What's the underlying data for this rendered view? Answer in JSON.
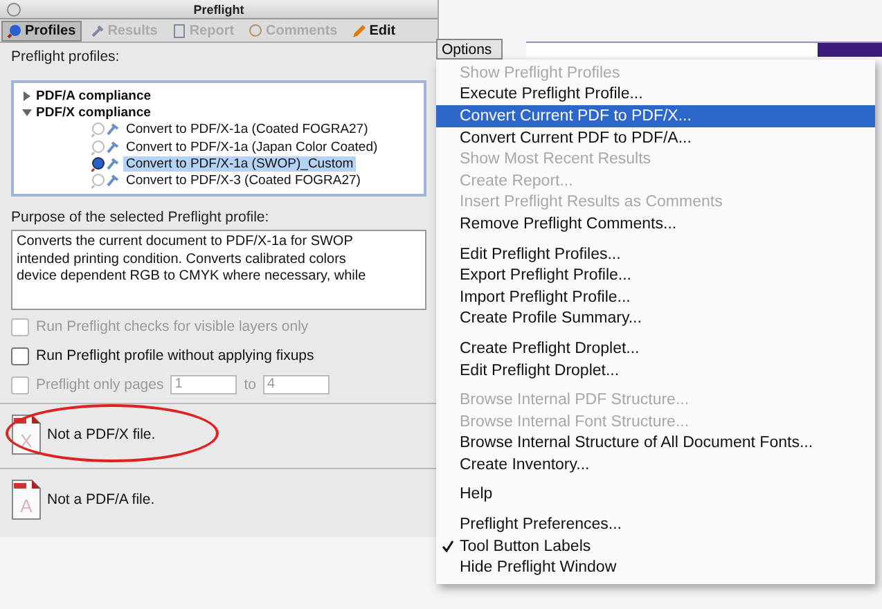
{
  "window": {
    "title": "Preflight"
  },
  "toolbar": [
    {
      "label": "Profiles",
      "selected": true,
      "disabled": false
    },
    {
      "label": "Results",
      "selected": false,
      "disabled": true
    },
    {
      "label": "Report",
      "selected": false,
      "disabled": true
    },
    {
      "label": "Comments",
      "selected": false,
      "disabled": true
    },
    {
      "label": "Edit",
      "selected": false,
      "disabled": false
    }
  ],
  "options_menu": {
    "label": "Options",
    "expanded": true,
    "items": [
      {
        "kind": "item",
        "label": "Show Preflight Profiles",
        "disabled": true,
        "selected": false,
        "checked": false
      },
      {
        "kind": "item",
        "label": "Execute Preflight Profile...",
        "disabled": false,
        "selected": false,
        "checked": false
      },
      {
        "kind": "item",
        "label": "Convert Current PDF to PDF/X...",
        "disabled": false,
        "selected": true,
        "checked": false
      },
      {
        "kind": "item",
        "label": "Convert Current PDF to PDF/A...",
        "disabled": false,
        "selected": false,
        "checked": false
      },
      {
        "kind": "item",
        "label": "Show Most Recent Results",
        "disabled": true,
        "selected": false,
        "checked": false
      },
      {
        "kind": "item",
        "label": "Create Report...",
        "disabled": true,
        "selected": false,
        "checked": false
      },
      {
        "kind": "item",
        "label": "Insert Preflight Results as Comments",
        "disabled": true,
        "selected": false,
        "checked": false
      },
      {
        "kind": "item",
        "label": "Remove Preflight Comments...",
        "disabled": false,
        "selected": false,
        "checked": false
      },
      {
        "kind": "separator"
      },
      {
        "kind": "item",
        "label": "Edit Preflight Profiles...",
        "disabled": false,
        "selected": false,
        "checked": false
      },
      {
        "kind": "item",
        "label": "Export Preflight Profile...",
        "disabled": false,
        "selected": false,
        "checked": false
      },
      {
        "kind": "item",
        "label": "Import Preflight Profile...",
        "disabled": false,
        "selected": false,
        "checked": false
      },
      {
        "kind": "item",
        "label": "Create Profile Summary...",
        "disabled": false,
        "selected": false,
        "checked": false
      },
      {
        "kind": "separator"
      },
      {
        "kind": "item",
        "label": "Create Preflight Droplet...",
        "disabled": false,
        "selected": false,
        "checked": false
      },
      {
        "kind": "item",
        "label": "Edit Preflight Droplet...",
        "disabled": false,
        "selected": false,
        "checked": false
      },
      {
        "kind": "separator"
      },
      {
        "kind": "item",
        "label": "Browse Internal PDF Structure...",
        "disabled": true,
        "selected": false,
        "checked": false
      },
      {
        "kind": "item",
        "label": "Browse Internal Font Structure...",
        "disabled": true,
        "selected": false,
        "checked": false
      },
      {
        "kind": "item",
        "label": "Browse Internal Structure of All Document Fonts...",
        "disabled": false,
        "selected": false,
        "checked": false
      },
      {
        "kind": "item",
        "label": "Create Inventory...",
        "disabled": false,
        "selected": false,
        "checked": false
      },
      {
        "kind": "separator"
      },
      {
        "kind": "item",
        "label": "Help",
        "disabled": false,
        "selected": false,
        "checked": false
      },
      {
        "kind": "separator"
      },
      {
        "kind": "item",
        "label": "Preflight Preferences...",
        "disabled": false,
        "selected": false,
        "checked": false
      },
      {
        "kind": "item",
        "label": "Tool Button Labels",
        "disabled": false,
        "selected": false,
        "checked": true
      },
      {
        "kind": "item",
        "label": "Hide Preflight Window",
        "disabled": false,
        "selected": false,
        "checked": false
      }
    ]
  },
  "profiles": {
    "label": "Preflight profiles:",
    "tree": [
      {
        "label": "PDF/A compliance",
        "expanded": false
      },
      {
        "label": "PDF/X compliance",
        "expanded": true,
        "children": [
          {
            "label": "Convert to PDF/X-1a (Coated FOGRA27)",
            "selected": false
          },
          {
            "label": "Convert to PDF/X-1a (Japan Color Coated)",
            "selected": false
          },
          {
            "label": "Convert to PDF/X-1a (SWOP)_Custom",
            "selected": true
          },
          {
            "label": "Convert to PDF/X-3 (Coated FOGRA27)",
            "selected": false
          }
        ]
      }
    ]
  },
  "purpose": {
    "label": "Purpose of the selected Preflight profile:",
    "lines": [
      "Converts the current document to PDF/X-1a for SWOP",
      "intended printing condition. Converts calibrated colors",
      "device dependent RGB to CMYK where necessary, while"
    ]
  },
  "options": [
    {
      "label": "Run Preflight checks for visible layers only",
      "checked": false,
      "disabled": true
    },
    {
      "label": "Run Preflight profile without applying fixups",
      "checked": false,
      "disabled": false
    }
  ],
  "page_range": {
    "label": "Preflight only pages",
    "checked": false,
    "disabled": true,
    "from": "1",
    "to_label": "to",
    "to": "4"
  },
  "results": [
    {
      "label": "Not a PDF/X file.",
      "badge": "X",
      "circled": true
    },
    {
      "label": "Not a PDF/A file.",
      "badge": "A",
      "circled": false
    }
  ]
}
